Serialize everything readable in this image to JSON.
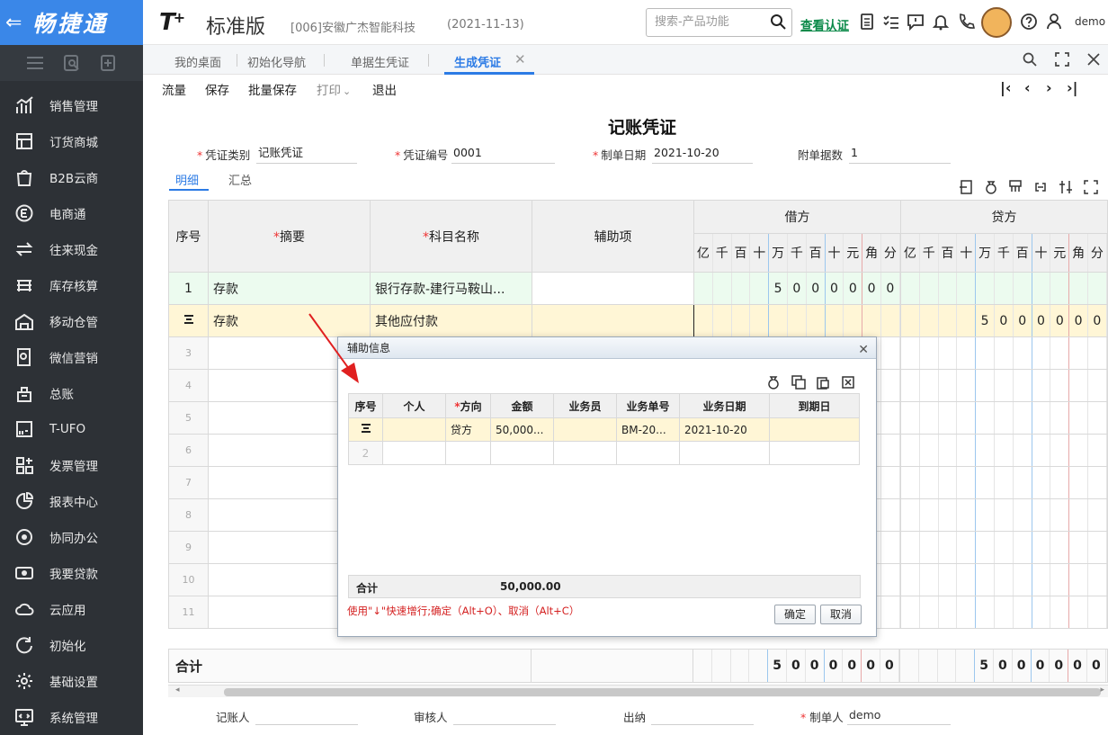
{
  "app": {
    "back_glyph": "⇐",
    "brand": "畅捷通"
  },
  "sidebar": {
    "items": [
      {
        "label": "销售管理",
        "icon": "sales-chart-icon"
      },
      {
        "label": "订货商城",
        "icon": "shop-icon"
      },
      {
        "label": "B2B云商",
        "icon": "b2b-bag-icon"
      },
      {
        "label": "电商通",
        "icon": "ecommerce-icon"
      },
      {
        "label": "往来现金",
        "icon": "exchange-icon"
      },
      {
        "label": "库存核算",
        "icon": "inventory-icon"
      },
      {
        "label": "移动仓管",
        "icon": "warehouse-icon"
      },
      {
        "label": "微信营销",
        "icon": "wechat-marketing-icon"
      },
      {
        "label": "总账",
        "icon": "ledger-icon"
      },
      {
        "label": "T-UFO",
        "icon": "tufo-icon"
      },
      {
        "label": "发票管理",
        "icon": "invoice-icon"
      },
      {
        "label": "报表中心",
        "icon": "report-pie-icon"
      },
      {
        "label": "协同办公",
        "icon": "collaboration-icon"
      },
      {
        "label": "我要贷款",
        "icon": "loan-icon"
      },
      {
        "label": "云应用",
        "icon": "cloud-icon"
      },
      {
        "label": "初始化",
        "icon": "init-icon"
      },
      {
        "label": "基础设置",
        "icon": "settings-icon"
      },
      {
        "label": "系统管理",
        "icon": "system-icon"
      }
    ]
  },
  "header": {
    "product_logo": "T",
    "product_sup": "+",
    "edition": "标准版",
    "company": "[006]安徽广杰智能科技",
    "date": "(2021-11-13)",
    "search_placeholder": "搜索-产品功能",
    "verify_link": "查看认证",
    "user": "demo"
  },
  "tabs": [
    {
      "label": "我的桌面"
    },
    {
      "label": "初始化导航"
    },
    {
      "label": "单据生凭证"
    },
    {
      "label": "生成凭证",
      "active": true
    }
  ],
  "toolbar": {
    "flow": "流量",
    "save": "保存",
    "batch_save": "批量保存",
    "print": "打印",
    "print_caret": "⌄",
    "exit": "退出"
  },
  "voucher": {
    "title": "记账凭证",
    "type_label": "凭证类别",
    "type_value": "记账凭证",
    "no_label": "凭证编号",
    "no_value": "0001",
    "date_label": "制单日期",
    "date_value": "2021-10-20",
    "attach_label": "附单据数",
    "attach_value": "1",
    "subtab_detail": "明细",
    "subtab_summary": "汇总",
    "col_seq": "序号",
    "col_summary": "摘要",
    "col_account": "科目名称",
    "col_aux": "辅助项",
    "col_debit": "借方",
    "col_credit": "贷方",
    "digits": [
      "亿",
      "千",
      "百",
      "十",
      "万",
      "千",
      "百",
      "十",
      "元",
      "角",
      "分"
    ],
    "rows": [
      {
        "seq": "1",
        "summary": "存款",
        "account": "银行存款-建行马鞍山...",
        "debit": [
          "",
          "",
          "",
          "",
          "5",
          "0",
          "0",
          "0",
          "0",
          "0",
          "0"
        ],
        "credit": [
          "",
          "",
          "",
          "",
          "",
          "",
          "",
          "",
          "",
          "",
          ""
        ]
      },
      {
        "seq": "",
        "summary": "存款",
        "account": "其他应付款",
        "debit": [
          "",
          "",
          "",
          "",
          "",
          "",
          "",
          "",
          "",
          "",
          ""
        ],
        "credit": [
          "",
          "",
          "",
          "",
          "5",
          "0",
          "0",
          "0",
          "0",
          "0",
          "0"
        ]
      },
      {
        "seq": "3"
      },
      {
        "seq": "4"
      },
      {
        "seq": "5"
      },
      {
        "seq": "6"
      },
      {
        "seq": "7"
      },
      {
        "seq": "8"
      },
      {
        "seq": "9"
      },
      {
        "seq": "10"
      },
      {
        "seq": "11"
      }
    ],
    "total_label": "合计",
    "total_debit": [
      "",
      "",
      "",
      "",
      "5",
      "0",
      "0",
      "0",
      "0",
      "0",
      "0"
    ],
    "total_credit": [
      "",
      "",
      "",
      "",
      "5",
      "0",
      "0",
      "0",
      "0",
      "0",
      "0"
    ]
  },
  "footer": {
    "bookkeeper": "记账人",
    "auditor": "审核人",
    "cashier": "出纳",
    "maker_label": "制单人",
    "maker_value": "demo"
  },
  "dialog": {
    "title": "辅助信息",
    "columns": [
      "序号",
      "个人",
      "方向",
      "金额",
      "业务员",
      "业务单号",
      "业务日期",
      "到期日"
    ],
    "rows": [
      {
        "seq": "",
        "person": "",
        "direction": "贷方",
        "amount": "50,000...",
        "salesman": "",
        "doc_no": "BM-20...",
        "biz_date": "2021-10-20",
        "due_date": ""
      },
      {
        "seq": "2",
        "person": "",
        "direction": "",
        "amount": "",
        "salesman": "",
        "doc_no": "",
        "biz_date": "",
        "due_date": ""
      }
    ],
    "total_label": "合计",
    "total_amount": "50,000.00",
    "hint": "使用\"↓\"快速增行;确定（Alt+O）、取消（Alt+C）",
    "ok": "确定",
    "cancel": "取消"
  },
  "colors": {
    "accent": "#2c7be5",
    "sidebar_bg": "#2d3136",
    "logo_bg": "#3a87e8",
    "verify_green": "#0c8a4a",
    "row1_bg": "#ecfbef",
    "row2_bg": "#fff6d6",
    "required_red": "#e33"
  }
}
